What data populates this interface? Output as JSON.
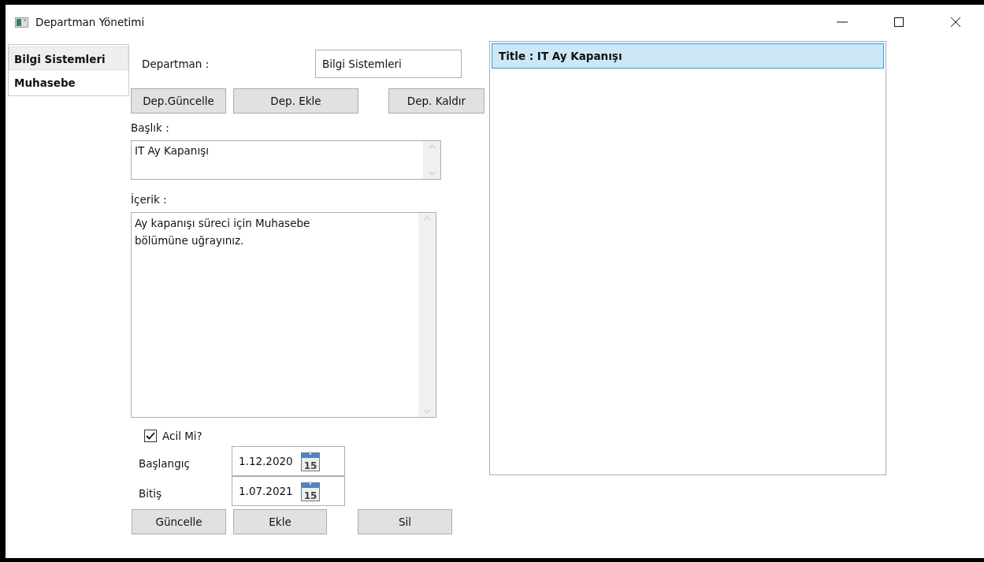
{
  "window": {
    "title": "Departman Yönetimi"
  },
  "departments": [
    {
      "label": "Bilgi Sistemleri",
      "selected": true
    },
    {
      "label": "Muhasebe",
      "selected": false
    }
  ],
  "department_field": {
    "label": "Departman :",
    "value": "Bilgi Sistemleri"
  },
  "department_buttons": [
    "Dep.Güncelle",
    "Dep. Ekle",
    "Dep. Kaldır"
  ],
  "title_field": {
    "label": "Başlık :",
    "value": "IT Ay Kapanışı"
  },
  "content_field": {
    "label": "İçerik :",
    "value": "Ay kapanışı süreci için Muhasebe\nbölümüne uğrayınız."
  },
  "urgent": {
    "label": "Acil Mi?",
    "checked": true
  },
  "start": {
    "label": "Başlangıç",
    "value": "1.12.2020",
    "day": "15"
  },
  "end": {
    "label": "Bitiş",
    "value": "1.07.2021",
    "day": "15"
  },
  "buttons": [
    "Güncelle",
    "Ekle",
    "Sil"
  ],
  "notes": [
    {
      "label": "Title : IT Ay Kapanışı",
      "selected": true
    }
  ]
}
